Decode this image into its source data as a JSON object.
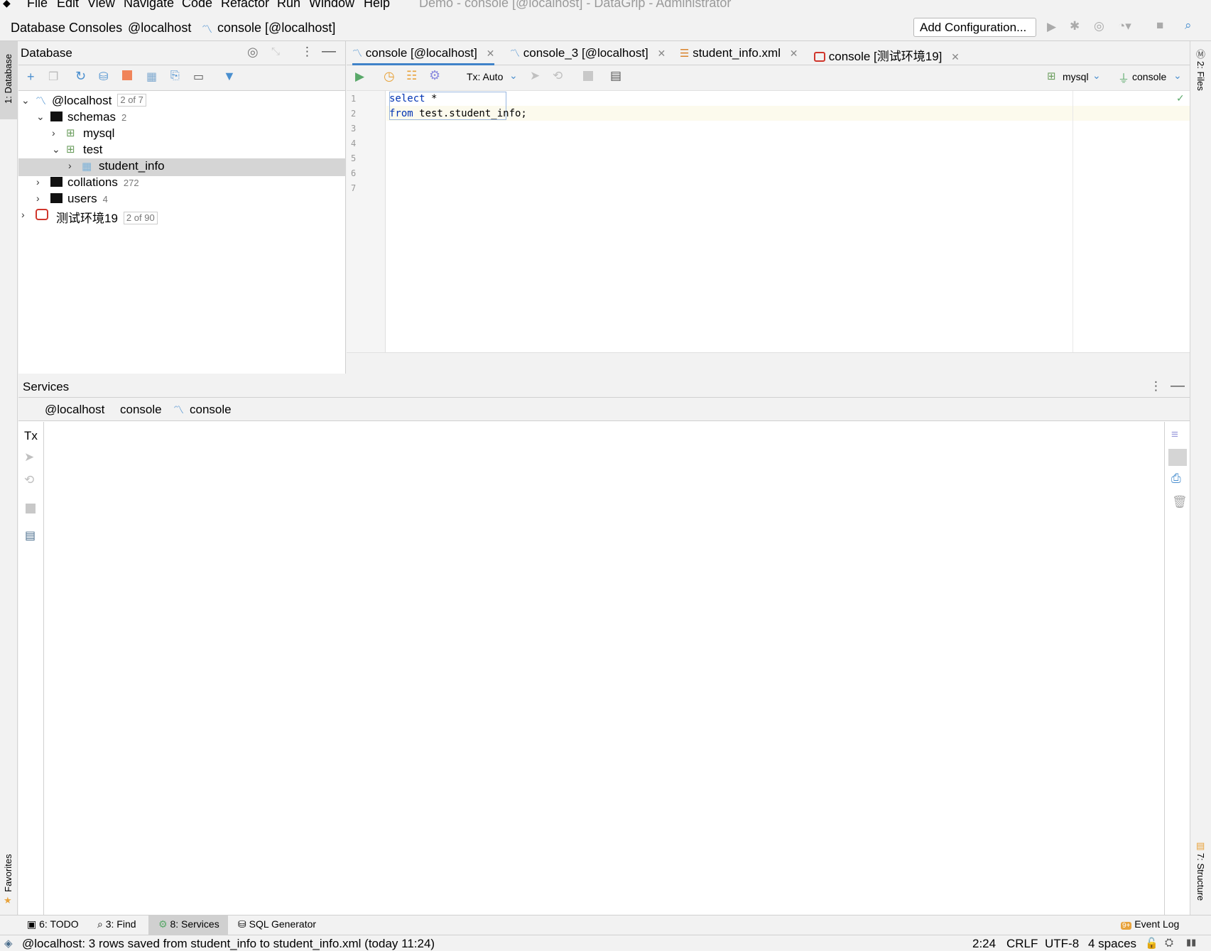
{
  "menu": {
    "items": [
      "File",
      "Edit",
      "View",
      "Navigate",
      "Code",
      "Refactor",
      "Run",
      "Window",
      "Help"
    ],
    "window_title": "Demo - console [@localhost] - DataGrip - Administrator"
  },
  "navbar": {
    "crumbs": [
      "Database Consoles",
      "@localhost",
      "console [@localhost]"
    ],
    "add_configuration": "Add Configuration..."
  },
  "left_strip": {
    "database_label": "1: Database",
    "favorites_label": "Favorites"
  },
  "right_strip": {
    "files_label": "2: Files",
    "structure_label": "7: Structure"
  },
  "database_panel": {
    "title": "Database",
    "tree": [
      {
        "label": "@localhost",
        "badge": "2 of 7"
      },
      {
        "label": "schemas",
        "count": "2"
      },
      {
        "label": "mysql"
      },
      {
        "label": "test"
      },
      {
        "label": "student_info"
      },
      {
        "label": "collations",
        "count": "272"
      },
      {
        "label": "users",
        "count": "4"
      },
      {
        "label": "测试环境19",
        "badge": "2 of 90"
      }
    ]
  },
  "editor": {
    "tabs": [
      {
        "label": "console [@localhost]"
      },
      {
        "label": "console_3 [@localhost]"
      },
      {
        "label": "student_info.xml"
      },
      {
        "label": "console [测试环境19]"
      }
    ],
    "tx_mode": "Tx: Auto",
    "schema_selector": "mysql",
    "session_selector": "console",
    "line_numbers": [
      "1",
      "2",
      "3",
      "4",
      "5",
      "6",
      "7"
    ],
    "code": {
      "kw1": "select",
      "rest1": " *",
      "kw2": "from",
      "rest2": " test.student_info;"
    }
  },
  "services": {
    "title": "Services",
    "crumbs": [
      "@localhost",
      "console",
      "console"
    ],
    "tx_label": "Tx"
  },
  "bottom_tabs": [
    "6: TODO",
    "3: Find",
    "8: Services",
    "SQL Generator"
  ],
  "event_log": {
    "badge": "9+",
    "label": "Event Log"
  },
  "status": {
    "message": "@localhost: 3 rows saved from student_info to student_info.xml (today 11:24)",
    "position": "2:24",
    "line_sep": "CRLF",
    "encoding": "UTF-8",
    "indent": "4 spaces"
  },
  "colors": {
    "accent": "#4083c9",
    "run_green": "#59a869",
    "selection": "#d5d5d5"
  }
}
